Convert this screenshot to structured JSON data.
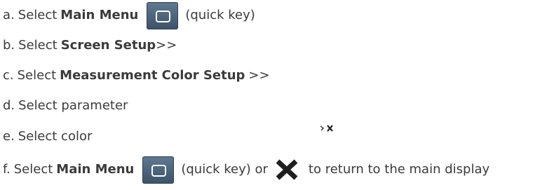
{
  "steps": [
    {
      "letter": "a.",
      "pre": "Select",
      "bold": "Main Menu",
      "icon": "main-menu-key-icon",
      "post": "(quick key)"
    },
    {
      "letter": "b.",
      "pre": "Select",
      "bold": "Screen Setup",
      "post": ">>"
    },
    {
      "letter": "c.",
      "pre": "Select",
      "bold": "Measurement Color Setup",
      "post": ">>"
    },
    {
      "letter": "d.",
      "text": "Select parameter"
    },
    {
      "letter": "e.",
      "text": "Select color"
    },
    {
      "letter": "f.",
      "pre": "Select",
      "bold": "Main Menu",
      "icon": "main-menu-key-icon",
      "mid": "(quick key) or",
      "icon2": "close-x-icon",
      "post": "to return to the main display"
    }
  ],
  "colors": {
    "text": "#3b3b3b",
    "menu_key_bg": "#4d657c",
    "close_x": "#1e1e1e"
  }
}
